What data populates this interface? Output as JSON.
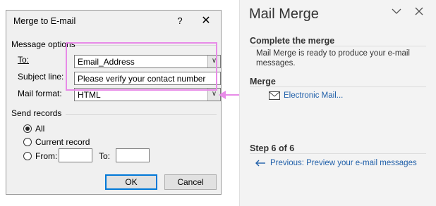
{
  "dialog": {
    "title": "Merge to E-mail",
    "help_label": "?",
    "message_options_label": "Message options",
    "to_label": "To:",
    "to_value": "Email_Address",
    "subject_label": "Subject line:",
    "subject_value": "Please verify your contact number",
    "mail_format_label": "Mail format:",
    "mail_format_value": "HTML",
    "send_records_label": "Send records",
    "radio_all": "All",
    "radio_current": "Current record",
    "radio_from": "From:",
    "to_range_label": "To:",
    "ok_label": "OK",
    "cancel_label": "Cancel"
  },
  "pane": {
    "title": "Mail Merge",
    "complete_heading": "Complete the merge",
    "complete_text": "Mail Merge is ready to produce your e-mail messages.",
    "merge_heading": "Merge",
    "electronic_mail_link": "Electronic Mail...",
    "step_heading": "Step 6 of 6",
    "previous_link": "Previous: Preview your e-mail messages"
  },
  "colors": {
    "highlight": "#e88be8",
    "link": "#1f5fa9"
  }
}
